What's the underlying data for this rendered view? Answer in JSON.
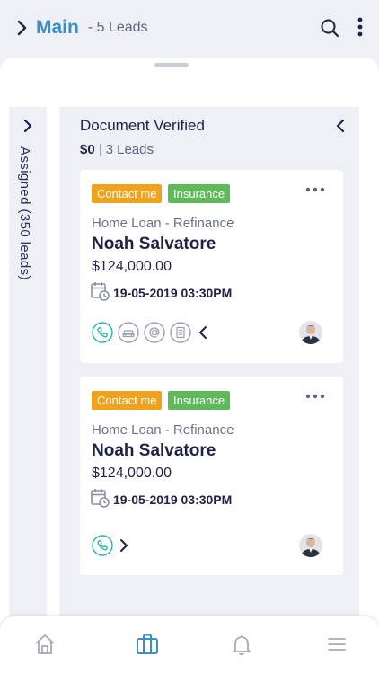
{
  "header": {
    "title": "Main",
    "count": "- 5 Leads"
  },
  "board": {
    "collapsed_column": {
      "label": "Assigned (350 leads)"
    },
    "column": {
      "title": "Document Verified",
      "amount": "$0",
      "separator": "|",
      "leads": "3 Leads"
    },
    "cards": [
      {
        "tag_contact": "Contact me",
        "tag_category": "Insurance",
        "product": "Home Loan - Refinance",
        "name": "Noah Salvatore",
        "amount": "$124,000.00",
        "date": "19-05-2019 03:30PM",
        "actions": [
          "phone-icon",
          "car-icon",
          "at-icon",
          "document-icon"
        ],
        "actions_expanded": true
      },
      {
        "tag_contact": "Contact me",
        "tag_category": "Insurance",
        "product": "Home Loan - Refinance",
        "name": "Noah Salvatore",
        "amount": "$124,000.00",
        "date": "19-05-2019 03:30PM",
        "actions": [
          "phone-icon"
        ],
        "actions_expanded": false
      }
    ]
  },
  "bottom_nav": {
    "items": [
      "home-icon",
      "briefcase-icon",
      "bell-icon",
      "menu-icon"
    ],
    "active": "briefcase-icon"
  },
  "colors": {
    "accent": "#3a8fc9",
    "tag_orange": "#efa21d",
    "tag_green": "#5fb95b",
    "action_icon": "#2bb3a5",
    "text_dark": "#1e2145",
    "column_bg": "#eef0f5"
  }
}
